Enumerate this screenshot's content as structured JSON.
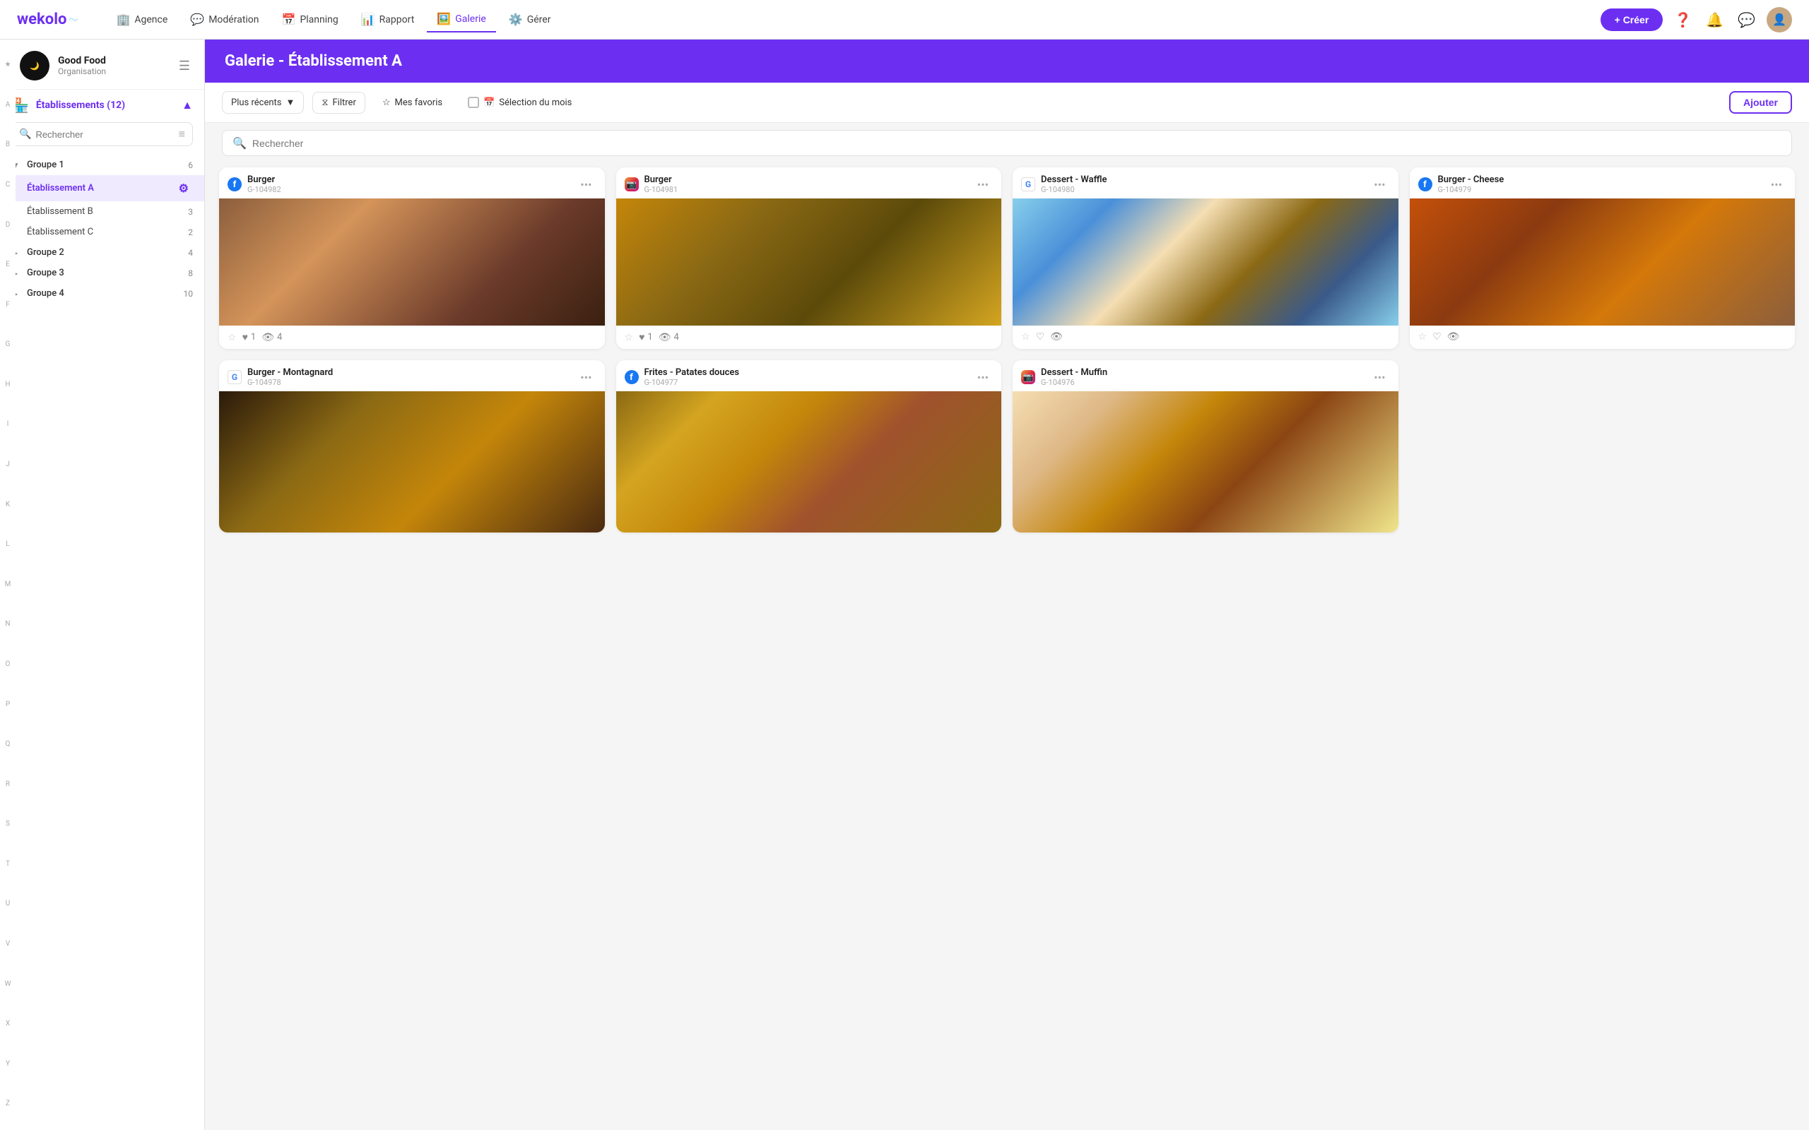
{
  "app": {
    "name": "wekolo"
  },
  "topnav": {
    "items": [
      {
        "id": "agence",
        "label": "Agence",
        "icon": "🏢",
        "active": false
      },
      {
        "id": "moderation",
        "label": "Modération",
        "icon": "💬",
        "active": false
      },
      {
        "id": "planning",
        "label": "Planning",
        "icon": "📅",
        "active": false
      },
      {
        "id": "rapport",
        "label": "Rapport",
        "icon": "📊",
        "active": false
      },
      {
        "id": "galerie",
        "label": "Galerie",
        "icon": "🖼️",
        "active": true
      },
      {
        "id": "gerer",
        "label": "Gérer",
        "icon": "⚙️",
        "active": false
      }
    ],
    "create_label": "+ Créer"
  },
  "sidebar": {
    "org": {
      "name": "Good Food",
      "sub": "Organisation"
    },
    "section_title": "Établissements (12)",
    "search_placeholder": "Rechercher",
    "groups": [
      {
        "id": "groupe1",
        "name": "Groupe 1",
        "count": 6,
        "expanded": true,
        "children": [
          {
            "id": "etabA",
            "name": "Établissement A",
            "count": null,
            "active": true
          },
          {
            "id": "etabB",
            "name": "Établissement B",
            "count": 3,
            "active": false
          },
          {
            "id": "etabC",
            "name": "Établissement C",
            "count": 2,
            "active": false
          }
        ]
      },
      {
        "id": "groupe2",
        "name": "Groupe 2",
        "count": 4,
        "expanded": false,
        "children": []
      },
      {
        "id": "groupe3",
        "name": "Groupe 3",
        "count": 8,
        "expanded": false,
        "children": []
      },
      {
        "id": "groupe4",
        "name": "Groupe 4",
        "count": 10,
        "expanded": false,
        "children": []
      }
    ],
    "alphabet": [
      "★",
      "A",
      "B",
      "C",
      "D",
      "E",
      "F",
      "G",
      "H",
      "I",
      "J",
      "K",
      "L",
      "M",
      "N",
      "O",
      "P",
      "Q",
      "R",
      "S",
      "T",
      "U",
      "V",
      "W",
      "X",
      "Y",
      "Z"
    ]
  },
  "page": {
    "title": "Galerie - Établissement A",
    "search_placeholder": "Rechercher"
  },
  "toolbar": {
    "sort_label": "Plus récents",
    "filter_label": "Filtrer",
    "fav_label": "Mes favoris",
    "selection_label": "Sélection du mois",
    "add_label": "Ajouter"
  },
  "gallery": {
    "cards": [
      {
        "id": "g1",
        "platform": "facebook",
        "platform_icon": "f",
        "title": "Burger",
        "ref": "G-104982",
        "img_class": "img-burger1",
        "stars": 1,
        "hearts": 1,
        "views": 4,
        "has_star": true
      },
      {
        "id": "g2",
        "platform": "instagram",
        "platform_icon": "📷",
        "title": "Burger",
        "ref": "G-104981",
        "img_class": "img-burger2",
        "stars": 1,
        "hearts": 1,
        "views": 4,
        "has_star": true
      },
      {
        "id": "g3",
        "platform": "google",
        "platform_icon": "G",
        "title": "Dessert - Waffle",
        "ref": "G-104980",
        "img_class": "img-waffle",
        "stars": 0,
        "hearts": 0,
        "views": 0,
        "has_star": false
      },
      {
        "id": "g4",
        "platform": "facebook",
        "platform_icon": "f",
        "title": "Burger - Cheese",
        "ref": "G-104979",
        "img_class": "img-burger-cheese",
        "stars": 0,
        "hearts": 0,
        "views": 0,
        "has_star": false
      },
      {
        "id": "g5",
        "platform": "google",
        "platform_icon": "G",
        "title": "Burger - Montagnard",
        "ref": "G-104978",
        "img_class": "img-burger-mont",
        "stars": 0,
        "hearts": 0,
        "views": 0,
        "has_star": false
      },
      {
        "id": "g6",
        "platform": "facebook",
        "platform_icon": "f",
        "title": "Frites - Patates douces",
        "ref": "G-104977",
        "img_class": "img-frites",
        "stars": 0,
        "hearts": 0,
        "views": 0,
        "has_star": false
      },
      {
        "id": "g7",
        "platform": "instagram",
        "platform_icon": "📷",
        "title": "Dessert - Muffin",
        "ref": "G-104976",
        "img_class": "img-muffin",
        "stars": 0,
        "hearts": 0,
        "views": 0,
        "has_star": false
      }
    ]
  }
}
